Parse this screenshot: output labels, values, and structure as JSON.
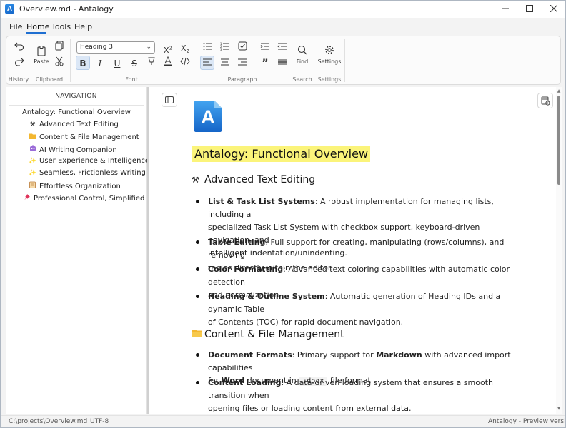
{
  "window": {
    "title": "Overview.md - Antalogy",
    "app_icon_letter": "A",
    "accent_color": "#1f6fd1"
  },
  "menu": [
    "File",
    "Home",
    "Tools",
    "Help"
  ],
  "ribbon": {
    "style_combo_value": "Heading 3",
    "paste_label": "Paste",
    "find_label": "Find",
    "settings_label": "Settings",
    "groups": [
      "History",
      "Clipboard",
      "Font",
      "Paragraph",
      "Search",
      "Settings"
    ],
    "font_buttons": [
      "B",
      "I",
      "U",
      "S"
    ]
  },
  "navigation": {
    "header": "NAVIGATION",
    "items": [
      {
        "label": "Antalogy: Functional Overview",
        "icon": ""
      },
      {
        "label": "Advanced Text Editing",
        "icon": "hammer-wrench-icon"
      },
      {
        "label": "Content & File Management",
        "icon": "folder-icon"
      },
      {
        "label": "AI Writing Companion",
        "icon": "robot-icon"
      },
      {
        "label": "User Experience & Intelligence",
        "icon": "sparkles-icon"
      },
      {
        "label": "Seamless, Frictionless Writing",
        "icon": "sparkles-icon"
      },
      {
        "label": "Effortless Organization",
        "icon": "clipboard-icon"
      },
      {
        "label": "Professional Control, Simplified",
        "icon": "pushpin-icon"
      }
    ]
  },
  "document": {
    "logo_letter": "A",
    "title": "Antalogy: Functional Overview",
    "sections": [
      {
        "heading": "Advanced Text Editing",
        "icon": "hammer-wrench-icon",
        "bullets": [
          {
            "bold": "List & Task List Systems",
            "line1": ": A robust implementation for managing lists, including a",
            "line2": "specialized Task List System with checkbox support, keyboard-driven navigation, and",
            "line3": "intelligent indentation/unindenting."
          },
          {
            "bold": "Table Editing",
            "line1": ": Full support for creating, manipulating (rows/columns), and removing",
            "line2": "tables directly within the editor."
          },
          {
            "bold": "Color Formatting",
            "line1": ": Advanced text coloring capabilities with automatic color detection",
            "line2": "and normalization."
          },
          {
            "bold": "Heading & Outline System",
            "line1": ": Automatic generation of Heading IDs and a dynamic Table",
            "line2": "of Contents (TOC) for rapid document navigation."
          }
        ]
      },
      {
        "heading": "Content & File Management",
        "icon": "folder-icon",
        "bullets": [
          {
            "bold": "Document Formats",
            "line1a": ": Primary support for ",
            "bold2": "Markdown",
            "line1b": " with advanced import capabilities",
            "line2a": "for ",
            "bold3": "Word",
            "line2b": " document in ",
            "code": ".docx",
            "line2c": " file format ."
          },
          {
            "bold": "Content Loading",
            "line1": ": A data-driven loading system that ensures a smooth transition when",
            "line2": "opening files or loading content from external data."
          }
        ]
      }
    ]
  },
  "status": {
    "path": "C:\\projects\\Overview.md",
    "encoding": "UTF-8",
    "version": "Antalogy - Preview version"
  }
}
